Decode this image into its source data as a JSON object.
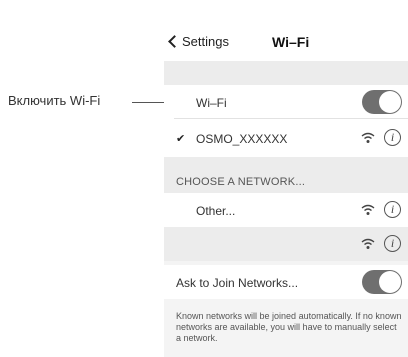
{
  "callout": {
    "label": "Включить Wi-Fi"
  },
  "nav": {
    "back_label": "Settings",
    "title": "Wi–Fi"
  },
  "wifi_toggle": {
    "label": "Wi–Fi",
    "on": true
  },
  "connected": {
    "name": "OSMO_XXXXXX",
    "check": "✔"
  },
  "choose_header": "CHOOSE A NETWORK...",
  "other": {
    "label": "Other..."
  },
  "ask_join": {
    "label": "Ask to Join Networks...",
    "on": true
  },
  "footer": "Known networks will be joined automatically. If no known networks are available, you will have to manually select a network.",
  "icons": {
    "wifi": "wifi-icon",
    "info": "info-icon",
    "check": "checkmark-icon",
    "back": "chevron-left-icon"
  },
  "colors": {
    "toggle_on": "#6f6f6f",
    "band": "#ececec",
    "screen_bg": "#f4f4f4"
  }
}
